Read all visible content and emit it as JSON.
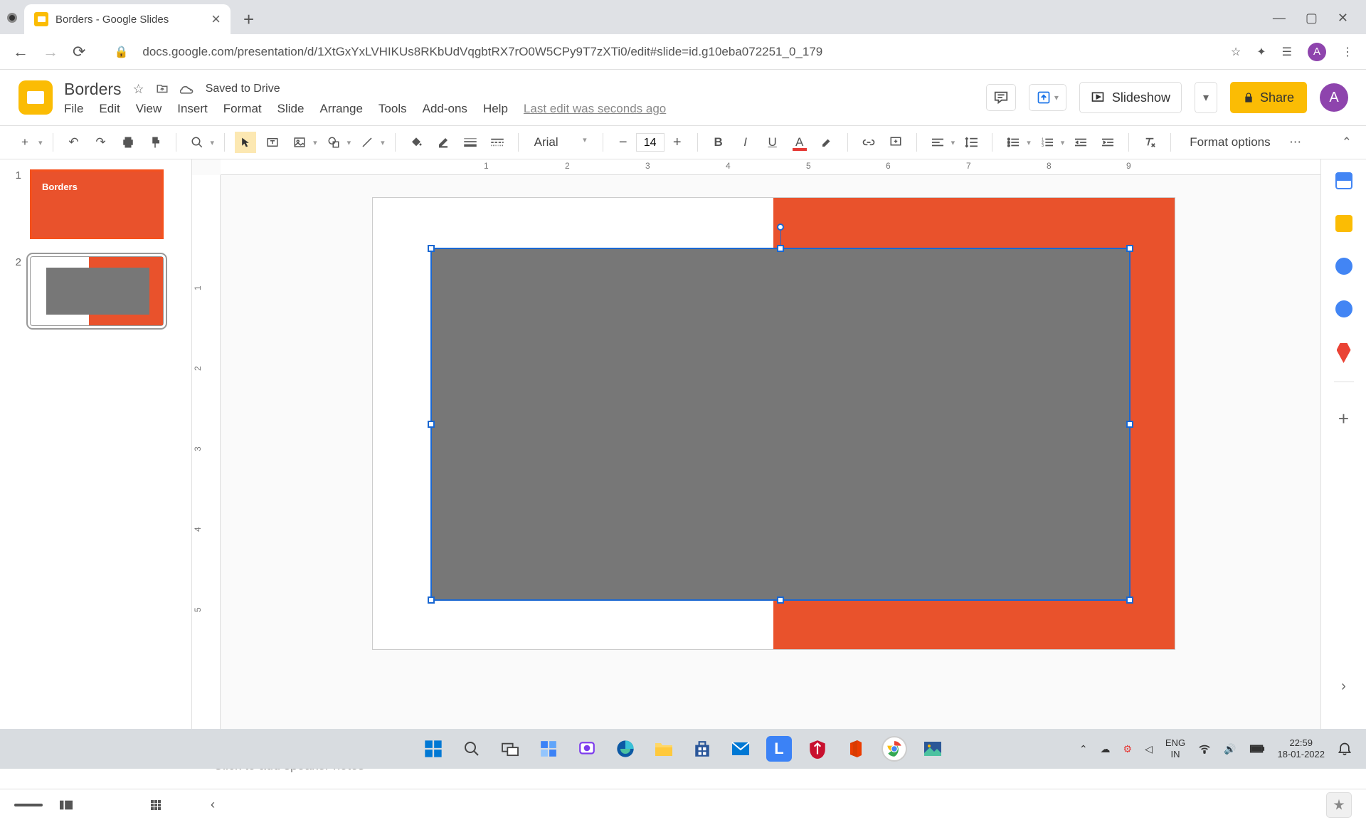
{
  "browser": {
    "tab_title": "Borders - Google Slides",
    "url": "docs.google.com/presentation/d/1XtGxYxLVHIKUs8RKbUdVqgbtRX7rO0W5CPy9T7zXTi0/edit#slide=id.g10eba072251_0_179",
    "profile_letter": "A"
  },
  "app": {
    "doc_title": "Borders",
    "saved_status": "Saved to Drive",
    "last_edit": "Last edit was seconds ago",
    "menus": [
      "File",
      "Edit",
      "View",
      "Insert",
      "Format",
      "Slide",
      "Arrange",
      "Tools",
      "Add-ons",
      "Help"
    ],
    "slideshow_label": "Slideshow",
    "share_label": "Share",
    "avatar_letter": "A"
  },
  "toolbar": {
    "font_family": "Arial",
    "font_size": "14",
    "format_options": "Format options"
  },
  "slides": {
    "thumb1_num": "1",
    "thumb1_title": "Borders",
    "thumb2_num": "2"
  },
  "ruler": {
    "h_marks": [
      "1",
      "2",
      "3",
      "4",
      "5",
      "6",
      "7",
      "8",
      "9"
    ],
    "v_marks": [
      "1",
      "2",
      "3",
      "4",
      "5"
    ]
  },
  "canvas": {
    "orange_color": "#e9522c",
    "grey_color": "#777777",
    "selection_color": "#1967d2"
  },
  "notes": {
    "placeholder": "Click to add speaker notes"
  },
  "taskbar": {
    "lang_top": "ENG",
    "lang_bottom": "IN",
    "time": "22:59",
    "date": "18-01-2022"
  }
}
